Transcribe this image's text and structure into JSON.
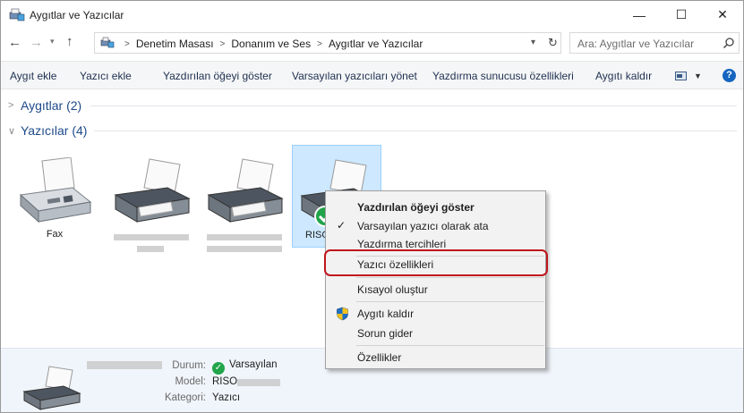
{
  "window": {
    "title": "Aygıtlar ve Yazıcılar",
    "controls": {
      "minimize": "—",
      "maximize": "☐",
      "close": "✕"
    }
  },
  "address": {
    "breadcrumbs": [
      "Denetim Masası",
      "Donanım ve Ses",
      "Aygıtlar ve Yazıcılar"
    ],
    "search_placeholder": "Ara: Aygıtlar ve Yazıcılar"
  },
  "toolbar": {
    "items": [
      "Aygıt ekle",
      "Yazıcı ekle",
      "Yazdırılan öğeyi göster",
      "Varsayılan yazıcıları yönet",
      "Yazdırma sunucusu özellikleri",
      "Aygıtı kaldır"
    ],
    "help": "?"
  },
  "groups": {
    "devices": {
      "label": "Aygıtlar (2)",
      "state": "collapsed"
    },
    "printers": {
      "label": "Yazıcılar (4)",
      "state": "expanded"
    }
  },
  "printers": [
    {
      "label": "Fax",
      "icon": "fax-icon"
    },
    {
      "label": "",
      "icon": "printer-icon",
      "label_obscured": true
    },
    {
      "label": "",
      "icon": "printer-icon",
      "label_obscured": true
    },
    {
      "label": "RISO",
      "icon": "printer-icon",
      "selected": true,
      "default": true
    }
  ],
  "details": {
    "status_label": "Durum:",
    "status_value": "Varsayılan",
    "model_label": "Model:",
    "model_value": "RISO",
    "category_label": "Kategori:",
    "category_value": "Yazıcı"
  },
  "context_menu": {
    "items": [
      {
        "label": "Yazdırılan öğeyi göster",
        "bold": true
      },
      {
        "label": "Varsayılan yazıcı olarak ata",
        "checked": true
      },
      {
        "label": "Yazdırma tercihleri"
      },
      {
        "label": "Yazıcı özellikleri",
        "highlighted": true
      },
      {
        "label": "Kısayol oluştur"
      },
      {
        "label": "Aygıtı kaldır",
        "icon": "shield-icon"
      },
      {
        "label": "Sorun gider"
      },
      {
        "label": "Özellikler"
      }
    ]
  },
  "colors": {
    "accent": "#1565c0",
    "selection": "#cde8ff",
    "highlight_ring": "#c0151d",
    "status_ok": "#21a44a"
  }
}
